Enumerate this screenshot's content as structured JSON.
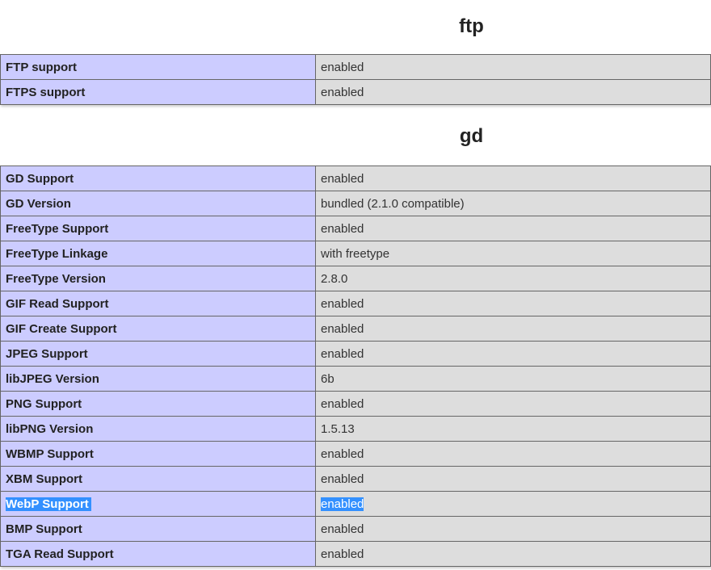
{
  "ftp": {
    "title": "ftp",
    "rows": [
      {
        "key": "FTP support",
        "value": "enabled"
      },
      {
        "key": "FTPS support",
        "value": "enabled"
      }
    ]
  },
  "gd": {
    "title": "gd",
    "rows": [
      {
        "key": "GD Support",
        "value": "enabled"
      },
      {
        "key": "GD Version",
        "value": "bundled (2.1.0 compatible)"
      },
      {
        "key": "FreeType Support",
        "value": "enabled"
      },
      {
        "key": "FreeType Linkage",
        "value": "with freetype"
      },
      {
        "key": "FreeType Version",
        "value": "2.8.0"
      },
      {
        "key": "GIF Read Support",
        "value": "enabled"
      },
      {
        "key": "GIF Create Support",
        "value": "enabled"
      },
      {
        "key": "JPEG Support",
        "value": "enabled"
      },
      {
        "key": "libJPEG Version",
        "value": "6b"
      },
      {
        "key": "PNG Support",
        "value": "enabled"
      },
      {
        "key": "libPNG Version",
        "value": "1.5.13"
      },
      {
        "key": "WBMP Support",
        "value": "enabled"
      },
      {
        "key": "XBM Support",
        "value": "enabled"
      },
      {
        "key": "WebP Support",
        "value": "enabled"
      },
      {
        "key": "BMP Support",
        "value": "enabled"
      },
      {
        "key": "TGA Read Support",
        "value": "enabled"
      }
    ]
  },
  "selection": {
    "highlight_color": "#3390ff",
    "selected_row": "WebP Support"
  }
}
